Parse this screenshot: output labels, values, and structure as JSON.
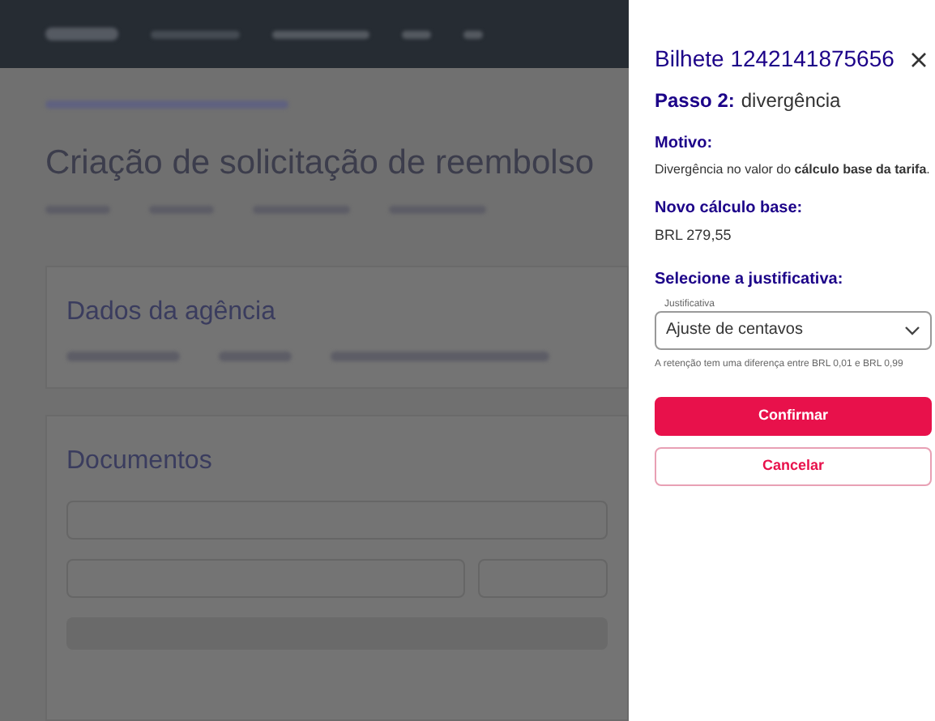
{
  "background_page": {
    "title": "Criação de solicitação de reembolso",
    "sections": [
      "Dados da agência",
      "Documentos"
    ]
  },
  "drawer": {
    "title": "Bilhete 1242141875656",
    "step_label": "Passo 2:",
    "step_name": "divergência",
    "reason_label": "Motivo:",
    "reason_text": "Divergência no valor do **cálculo base da tarifa**.",
    "new_base_label": "Novo cálculo base:",
    "new_base_value": "BRL 279,55",
    "justification_label": "Selecione a justificativa:",
    "justification_field": {
      "label": "Justificativa",
      "value": "Ajuste de centavos",
      "helper": "A retenção tem uma diferença entre BRL 0,01 e BRL 0,99"
    },
    "buttons": [
      {
        "label": "Confirmar",
        "kind": "primary"
      },
      {
        "label": "Cancelar",
        "kind": "secondary"
      }
    ]
  }
}
